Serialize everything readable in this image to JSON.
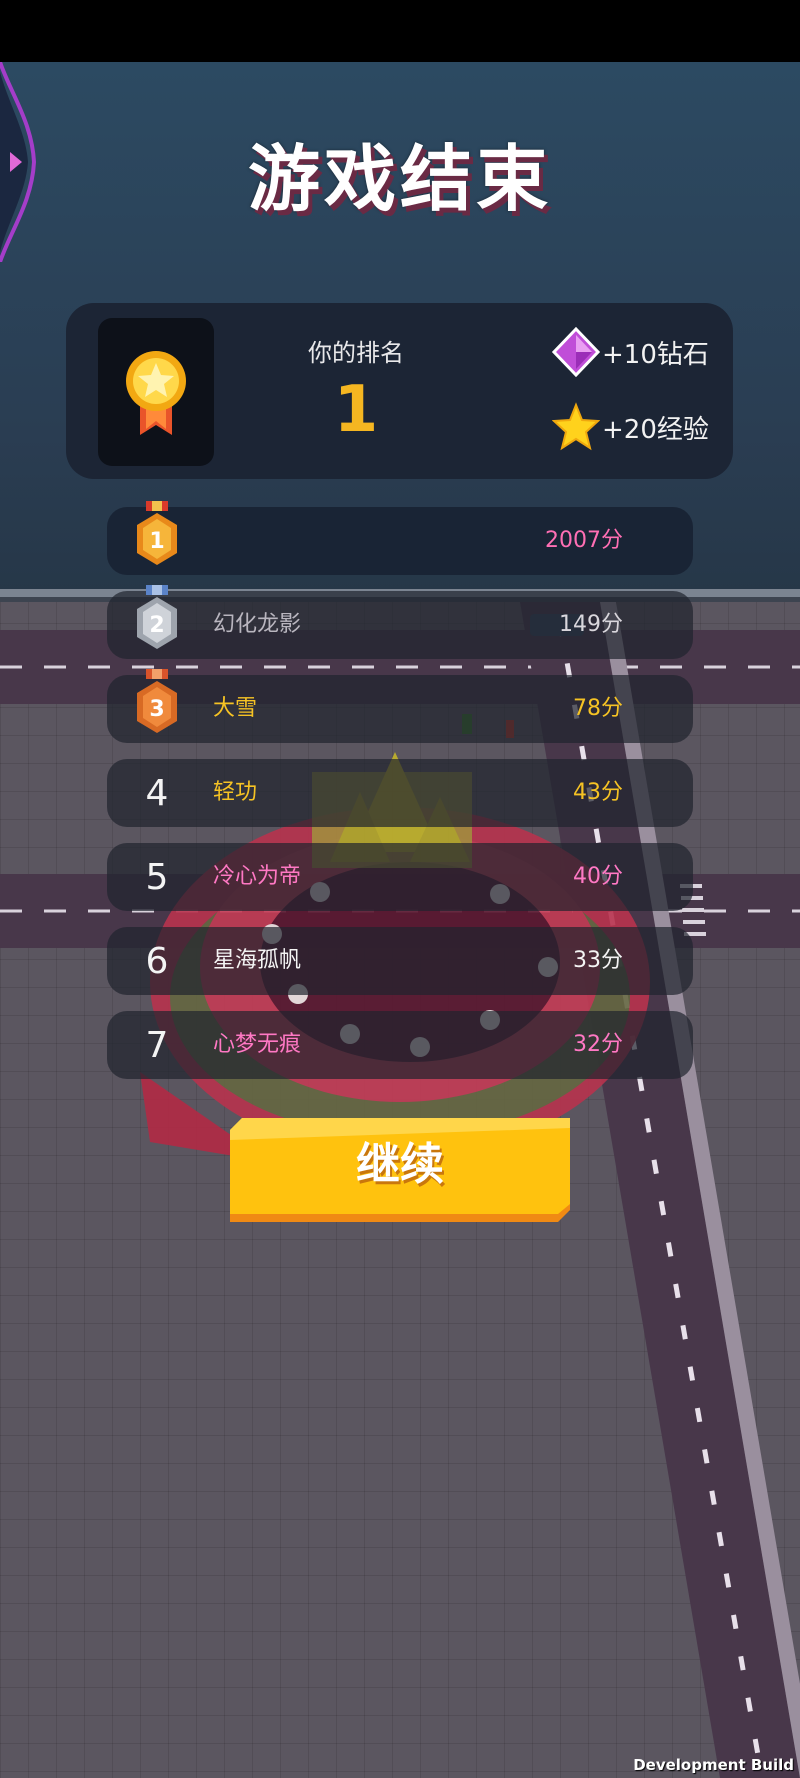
{
  "title": "游戏结束",
  "result": {
    "rank_label": "你的排名",
    "rank_value": "1",
    "rewards": [
      {
        "icon": "gem-icon",
        "text": "+10钻石"
      },
      {
        "icon": "star-icon",
        "text": "+20经验"
      }
    ]
  },
  "leaderboard": [
    {
      "rank": "1",
      "name": "",
      "score": "2007分",
      "medal": "gold",
      "name_color": "#ff6fb4",
      "score_color": "#ff6fb4"
    },
    {
      "rank": "2",
      "name": "幻化龙影",
      "score": "149分",
      "medal": "silver",
      "name_color": "#b9b6bf",
      "score_color": "#d9d6dc"
    },
    {
      "rank": "3",
      "name": "大雪",
      "score": "78分",
      "medal": "bronze",
      "name_color": "#f6c324",
      "score_color": "#f6c324"
    },
    {
      "rank": "4",
      "name": "轻功",
      "score": "43分",
      "medal": "",
      "name_color": "#f6c324",
      "score_color": "#f6c324"
    },
    {
      "rank": "5",
      "name": "冷心为帝",
      "score": "40分",
      "medal": "",
      "name_color": "#ff78c4",
      "score_color": "#ff78c4"
    },
    {
      "rank": "6",
      "name": "星海孤帆",
      "score": "33分",
      "medal": "",
      "name_color": "#f4f4f4",
      "score_color": "#f4f4f4"
    },
    {
      "rank": "7",
      "name": "心梦无痕",
      "score": "32分",
      "medal": "",
      "name_color": "#ff78c4",
      "score_color": "#ff78c4"
    }
  ],
  "continue_button": {
    "label": "继续"
  },
  "watermark": "Development Build",
  "colors": {
    "accent_gold": "#f5b621",
    "button_yellow": "#ffc20e",
    "panel_dark": "#1c2535"
  }
}
